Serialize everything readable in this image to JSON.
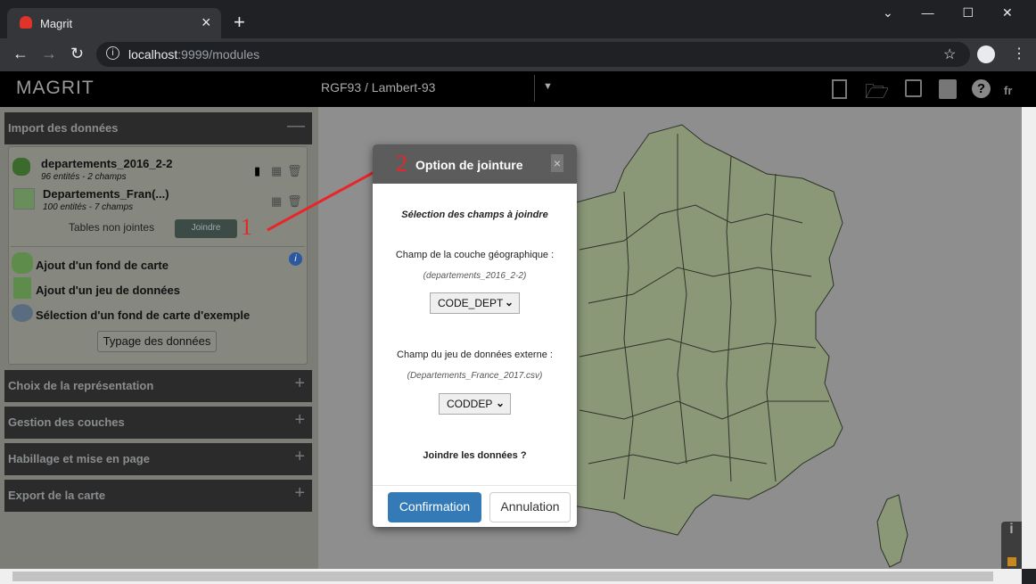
{
  "browser": {
    "tab_title": "Magrit",
    "url_host": "localhost",
    "url_path": ":9999/modules",
    "tab_close": "×",
    "new_tab": "+"
  },
  "app": {
    "logo": "MAGRIT",
    "projection": "RGF93 / Lambert-93",
    "lang": "fr"
  },
  "left_panel": {
    "import_title": "Import des données",
    "layers": [
      {
        "name": "departements_2016_2-2",
        "info": "96 entités - 2 champs"
      },
      {
        "name": "Departements_Fran(...)",
        "info": "100 entités - 7 champs"
      }
    ],
    "unjoined_label": "Tables non jointes",
    "join_button": "Joindre",
    "actions": [
      "Ajout d'un fond de carte",
      "Ajout d'un jeu de données",
      "Sélection d'un fond de carte d'exemple"
    ],
    "typing_button": "Typage des données",
    "sections": [
      "Choix de la représentation",
      "Gestion des couches",
      "Habillage et mise en page",
      "Export de la carte"
    ]
  },
  "annotations": {
    "one": "1",
    "two": "2",
    "color": "#e8262a"
  },
  "modal": {
    "title": "Option de jointure",
    "close": "×",
    "subtitle": "Sélection des champs à joindre",
    "geo_label": "Champ de la couche géographique :",
    "geo_layer": "(departements_2016_2-2)",
    "geo_field": "CODE_DEPT",
    "ext_label": "Champ du jeu de données externe :",
    "ext_layer": "(Departements_France_2017.csv)",
    "ext_field": "CODDEP",
    "question": "Joindre les données ?",
    "confirm": "Confirmation",
    "cancel": "Annulation"
  },
  "colors": {
    "accent": "#337ab7",
    "map_fill": "#8a9878"
  }
}
